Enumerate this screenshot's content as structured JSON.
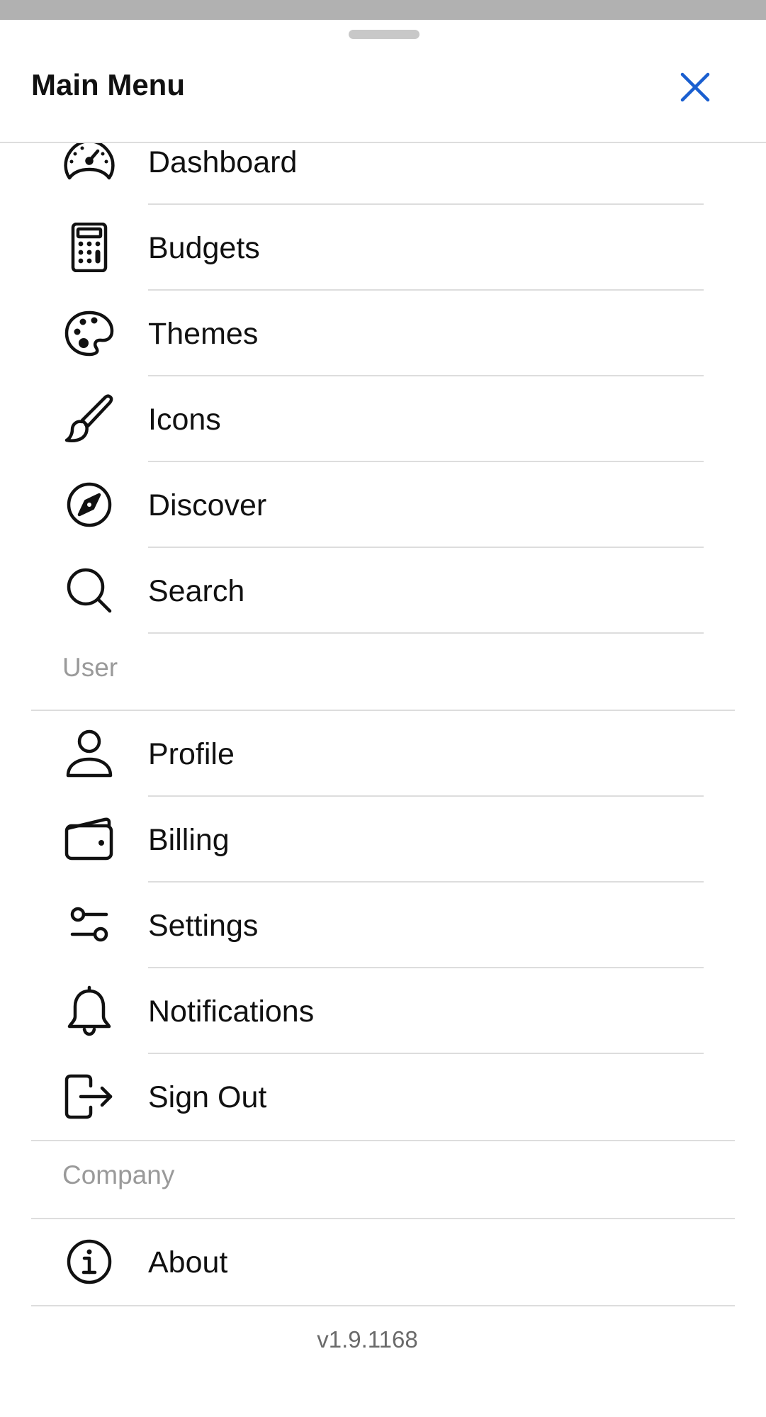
{
  "header": {
    "title": "Main Menu",
    "close_icon": "close-icon"
  },
  "main_items": [
    {
      "label": "Dashboard",
      "icon": "dashboard-gauge-icon"
    },
    {
      "label": "Budgets",
      "icon": "calculator-icon"
    },
    {
      "label": "Themes",
      "icon": "palette-icon"
    },
    {
      "label": "Icons",
      "icon": "brush-icon"
    },
    {
      "label": "Discover",
      "icon": "compass-icon"
    },
    {
      "label": "Search",
      "icon": "search-icon"
    }
  ],
  "user_section": {
    "label": "User",
    "items": [
      {
        "label": "Profile",
        "icon": "person-icon"
      },
      {
        "label": "Billing",
        "icon": "wallet-icon"
      },
      {
        "label": "Settings",
        "icon": "sliders-icon"
      },
      {
        "label": "Notifications",
        "icon": "bell-icon"
      },
      {
        "label": "Sign Out",
        "icon": "sign-out-icon"
      }
    ]
  },
  "company_section": {
    "label": "Company",
    "items": [
      {
        "label": "About",
        "icon": "info-icon"
      }
    ]
  },
  "footer": {
    "version": "v1.9.1168"
  },
  "colors": {
    "accent": "#1a5fd0",
    "divider": "#dddddd",
    "section_label": "#9a9a9a",
    "version_text": "#6a6a6a",
    "top_strip": "#b1b1b1"
  }
}
